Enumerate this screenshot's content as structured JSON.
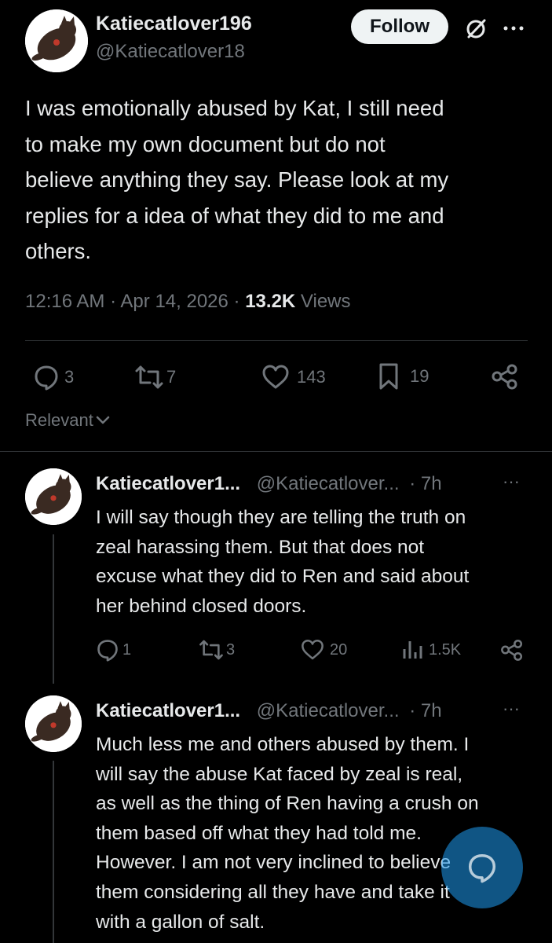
{
  "post": {
    "display_name": "Katiecatlover196",
    "handle": "@Katiecatlover18",
    "follow_label": "Follow",
    "text_lines": [
      "I was emotionally abused by Kat, I still need",
      "to make my own document but do not",
      "believe anything they say. Please look at my",
      "replies for a idea of what they did to me and",
      "others."
    ],
    "time": "12:16 AM",
    "sep1": "·",
    "date": "Apr 14, 2026",
    "sep2": "·",
    "views_count": "13.2K",
    "views_label": "Views",
    "replies": "3",
    "reposts": "7",
    "likes": "143",
    "bookmarks": "19"
  },
  "sort_label": "Relevant",
  "replies": [
    {
      "display_name": "Katiecatlover1...",
      "handle": "@Katiecatlover...",
      "age": "· 7h",
      "more": "···",
      "text_lines": [
        "I will say though they are telling the truth on",
        "zeal harassing them. But that does not",
        "excuse what they did to Ren and said about",
        "her behind closed doors."
      ],
      "replies": "1",
      "reposts": "3",
      "likes": "20",
      "views": "1.5K"
    },
    {
      "display_name": "Katiecatlover1...",
      "handle": "@Katiecatlover...",
      "age": "· 7h",
      "more": "···",
      "text_lines": [
        "Much less me and others abused by them. I",
        "will say the abuse Kat faced by zeal is real,",
        "as well as the thing of Ren having a crush on",
        "them based off what they had told me.",
        "However. I am not very inclined to believe",
        "them considering all they have and take it",
        "with a gallon of salt."
      ]
    }
  ],
  "colors": {
    "background": "#000000",
    "text": "#e7e9ea",
    "muted": "#71767b",
    "divider": "#2f3336",
    "fab": "#1d9bf0"
  },
  "icons": [
    "grok-icon",
    "more-icon",
    "reply-icon",
    "repost-icon",
    "like-icon",
    "bookmark-icon",
    "share-icon",
    "views-icon",
    "chevron-down-icon",
    "compose-icon"
  ]
}
